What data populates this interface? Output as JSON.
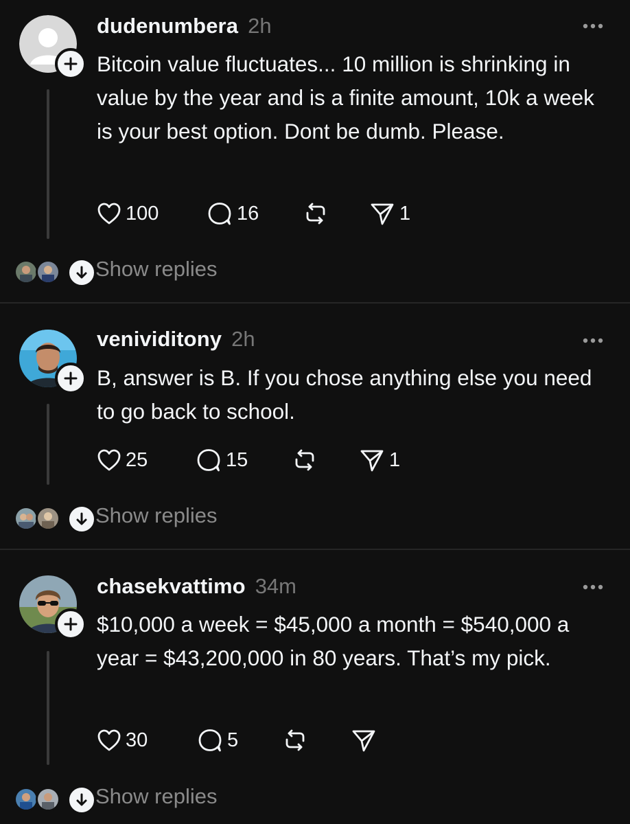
{
  "posts": [
    {
      "username": "dudenumbera",
      "time": "2h",
      "text": "Bitcoin value fluctuates... 10 million is shrinking in value by the year and is a finite amount, 10k a week is your best option. Dont be dumb. Please.",
      "likes": "100",
      "comments": "16",
      "shares": "1",
      "show_replies": "Show replies",
      "avatar": "default-avatar"
    },
    {
      "username": "venividitony",
      "time": "2h",
      "text": "B, answer is B. If you chose anything else you need to go back to school.",
      "likes": "25",
      "comments": "15",
      "shares": "1",
      "show_replies": "Show replies",
      "avatar": "photo-avatar"
    },
    {
      "username": "chasekvattimo",
      "time": "34m",
      "text": "$10,000 a week = $45,000 a month = $540,000 a year = $43,200,000 in 80 years. That’s my pick.",
      "likes": "30",
      "comments": "5",
      "shares": "",
      "show_replies": "Show replies",
      "avatar": "photo-avatar"
    }
  ],
  "icons": {
    "like": "heart-icon",
    "comment": "comment-icon",
    "repost": "repost-icon",
    "share": "send-icon",
    "more": "more-icon",
    "follow": "plus-icon",
    "expand": "arrow-down-icon"
  },
  "colors": {
    "background": "#101010",
    "text": "#f3f5f7",
    "muted": "#777777",
    "divider": "#262626"
  }
}
